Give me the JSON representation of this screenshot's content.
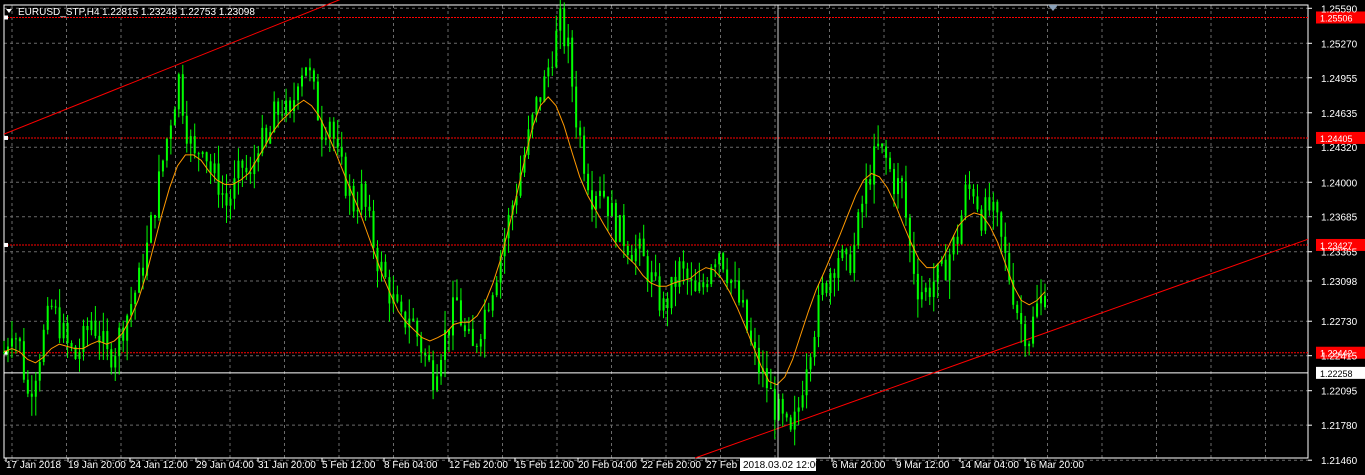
{
  "header": {
    "symbol": "EURUSD_STP,H4",
    "ohlc": "1.22815 1.23248 1.22753 1.23098"
  },
  "chart_data": {
    "type": "candlestick",
    "instrument": "EURUSD_STP",
    "timeframe": "H4",
    "ylim": [
      1.2148,
      1.2562
    ],
    "grid": true,
    "y_ticks": [
      "1.25590",
      "1.25270",
      "1.24955",
      "1.24635",
      "1.24320",
      "1.24000",
      "1.23685",
      "1.23365",
      "1.23098",
      "1.22730",
      "1.22415",
      "1.22095",
      "1.21780",
      "1.21460"
    ],
    "x_ticks": [
      "17 Jan 2018",
      "19 Jan 20:00",
      "24 Jan 12:00",
      "29 Jan 04:00",
      "31 Jan 20:00",
      "5 Feb 12:00",
      "8 Feb 04:00",
      "12 Feb 20:00",
      "15 Feb 12:00",
      "20 Feb 04:00",
      "22 Feb 20:00",
      "27 Feb",
      "6 Mar 20:00",
      "9 Mar 12:00",
      "14 Mar 04:00",
      "16 Mar 20:00"
    ],
    "crosshair_time": "2018.03.02 12:00",
    "current_price": "1.23098",
    "horizontal_levels": [
      {
        "value": 1.25506,
        "label": "1.25506",
        "color": "#ff0000"
      },
      {
        "value": 1.24405,
        "label": "1.24405",
        "color": "#ff0000"
      },
      {
        "value": 1.23427,
        "label": "1.23427",
        "color": "#ff0000"
      },
      {
        "value": 1.22442,
        "label": "1.22442",
        "color": "#ff0000"
      },
      {
        "value": 1.22258,
        "label": "1.22258",
        "color": "#ffffff"
      }
    ],
    "trendlines": [
      {
        "name": "upper",
        "from": [
          0.0,
          1.2444
        ],
        "to": [
          0.285,
          1.258
        ],
        "color": "#ff0000"
      },
      {
        "name": "lower",
        "from": [
          0.53,
          1.2148
        ],
        "to": [
          1.0,
          1.2348
        ],
        "color": "#ff0000"
      }
    ],
    "close_path": [
      1.2245,
      1.227,
      1.225,
      1.2205,
      1.223,
      1.226,
      1.2285,
      1.227,
      1.225,
      1.224,
      1.2255,
      1.2275,
      1.226,
      1.224,
      1.225,
      1.227,
      1.229,
      1.231,
      1.234,
      1.238,
      1.242,
      1.246,
      1.2495,
      1.245,
      1.242,
      1.244,
      1.241,
      1.24,
      1.238,
      1.2395,
      1.2415,
      1.24,
      1.244,
      1.243,
      1.246,
      1.247,
      1.2455,
      1.25,
      1.251,
      1.248,
      1.245,
      1.246,
      1.242,
      1.24,
      1.238,
      1.239,
      1.236,
      1.233,
      1.231,
      1.229,
      1.227,
      1.228,
      1.226,
      1.224,
      1.2225,
      1.225,
      1.227,
      1.229,
      1.226,
      1.2245,
      1.227,
      1.2295,
      1.232,
      1.235,
      1.238,
      1.241,
      1.244,
      1.247,
      1.249,
      1.252,
      1.2545,
      1.252,
      1.246,
      1.242,
      1.239,
      1.24,
      1.238,
      1.236,
      1.235,
      1.234,
      1.2335,
      1.232,
      1.23,
      1.2285,
      1.23,
      1.232,
      1.231,
      1.2295,
      1.2305,
      1.233,
      1.234,
      1.232,
      1.23,
      1.228,
      1.225,
      1.223,
      1.2215,
      1.2195,
      1.218,
      1.2165,
      1.2195,
      1.224,
      1.227,
      1.23,
      1.232,
      1.2335,
      1.232,
      1.234,
      1.238,
      1.241,
      1.243,
      1.242,
      1.24,
      1.2395,
      1.234,
      1.2305,
      1.23,
      1.231,
      1.2315,
      1.2335,
      1.235,
      1.239,
      1.2395,
      1.237,
      1.2375,
      1.236,
      1.233,
      1.23,
      1.227,
      1.226,
      1.2285,
      1.23
    ],
    "ma_path": [
      1.2245,
      1.2248,
      1.2245,
      1.2238,
      1.2235,
      1.224,
      1.2248,
      1.2252,
      1.225,
      1.2248,
      1.2248,
      1.2252,
      1.2255,
      1.2252,
      1.2255,
      1.2262,
      1.2275,
      1.2292,
      1.2315,
      1.2342,
      1.237,
      1.2395,
      1.2415,
      1.2425,
      1.2425,
      1.242,
      1.241,
      1.2402,
      1.2398,
      1.2398,
      1.2402,
      1.2408,
      1.242,
      1.2432,
      1.2445,
      1.2455,
      1.2462,
      1.247,
      1.2475,
      1.247,
      1.246,
      1.2445,
      1.2428,
      1.241,
      1.2392,
      1.2375,
      1.2355,
      1.2335,
      1.2315,
      1.2298,
      1.2282,
      1.2272,
      1.2265,
      1.2258,
      1.2255,
      1.2258,
      1.2262,
      1.227,
      1.2272,
      1.2272,
      1.2278,
      1.229,
      1.2308,
      1.233,
      1.2358,
      1.2388,
      1.242,
      1.245,
      1.247,
      1.2478,
      1.247,
      1.2452,
      1.2428,
      1.2405,
      1.2388,
      1.2375,
      1.2362,
      1.235,
      1.234,
      1.2332,
      1.2325,
      1.2315,
      1.2308,
      1.2305,
      1.2305,
      1.2308,
      1.231,
      1.2312,
      1.2318,
      1.2322,
      1.232,
      1.2312,
      1.23,
      1.2285,
      1.2268,
      1.225,
      1.2232,
      1.2218,
      1.2215,
      1.2222,
      1.2238,
      1.226,
      1.2282,
      1.2302,
      1.2318,
      1.2335,
      1.2352,
      1.237,
      1.2388,
      1.2402,
      1.2408,
      1.2405,
      1.2395,
      1.238,
      1.2362,
      1.2345,
      1.233,
      1.2322,
      1.2322,
      1.233,
      1.2345,
      1.236,
      1.2368,
      1.2372,
      1.237,
      1.236,
      1.2345,
      1.2325,
      1.2305,
      1.2292,
      1.2288,
      1.2292,
      1.23
    ],
    "candle_color": "#00ff00",
    "ma_color": "#ff9900",
    "trendline_color": "#ff0000"
  }
}
